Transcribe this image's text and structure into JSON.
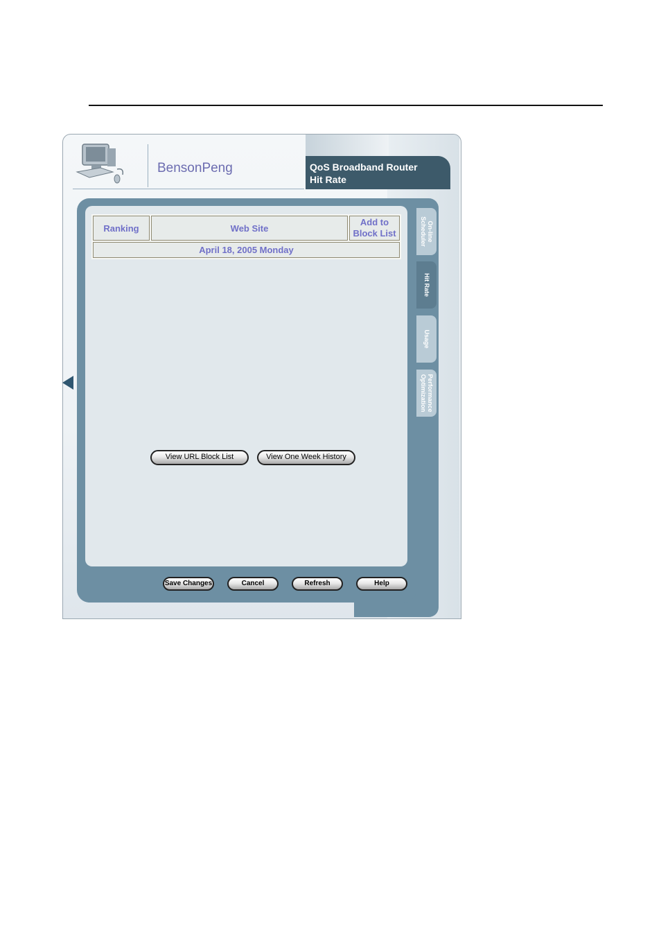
{
  "header": {
    "user_name": "BensonPeng",
    "title_line1": "QoS Broadband Router",
    "title_line2": "Hit Rate"
  },
  "table": {
    "columns": [
      "Ranking",
      "Web Site",
      "Add to Block List"
    ],
    "add_col_line1": "Add to",
    "add_col_line2": "Block List",
    "date_row": "April 18, 2005 Monday"
  },
  "tabs": [
    {
      "label": "On-line\nScheduler",
      "active": false
    },
    {
      "label": "Hit Rate",
      "active": true
    },
    {
      "label": "Usage",
      "active": false
    },
    {
      "label": "Performance\nOptimization",
      "active": false
    }
  ],
  "actions": {
    "view_block_list": "View URL Block List",
    "view_history": "View One Week History"
  },
  "footer_buttons": {
    "save": "Save Changes",
    "cancel": "Cancel",
    "refresh": "Refresh",
    "help": "Help"
  },
  "icons": {
    "logo": "computer-icon",
    "back": "left-triangle-icon"
  },
  "colors": {
    "accent": "#6d8fa3",
    "title_bg": "#3d5a6a",
    "label_text": "#7070c8"
  }
}
